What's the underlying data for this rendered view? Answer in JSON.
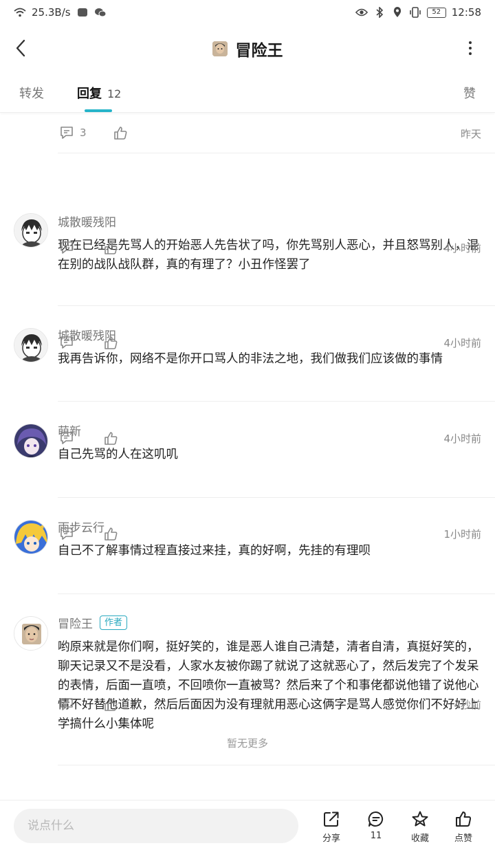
{
  "status_bar": {
    "network_speed": "25.3B/s",
    "battery": "52",
    "time": "12:58"
  },
  "header": {
    "title": "冒险王"
  },
  "tabs": {
    "forward": "转发",
    "reply": "回复",
    "reply_count": "12",
    "like": "赞"
  },
  "prev_comment": {
    "reply_count": "3",
    "time": "昨天"
  },
  "comments": [
    {
      "author": "城散暖残阳",
      "text": "现在已经是先骂人的开始恶人先告状了吗，你先骂别人恶心，并且怒骂别人，混在别的战队战队群，真的有理了？小丑作怪罢了",
      "time": "4小时前"
    },
    {
      "author": "城散暖残阳",
      "text": "我再告诉你，网络不是你开口骂人的非法之地，我们做我们应该做的事情",
      "time": "4小时前"
    },
    {
      "author": "萌新",
      "text": "自己先骂的人在这叽叽",
      "time": "4小时前"
    },
    {
      "author": "雨步云行",
      "text": "自己不了解事情过程直接过来挂，真的好啊，先挂的有理呗",
      "time": "1小时前"
    },
    {
      "author": "冒险王",
      "author_tag": "作者",
      "text": "哟原来就是你们啊，挺好笑的，谁是恶人谁自己清楚，清者自清，真挺好笑的，聊天记录又不是没看，人家水友被你踢了就说了这就恶心了，然后发完了个发呆的表情，后面一直喷，不回喷你一直被骂？然后来了个和事佬都说他错了说他心情不好替他道歉，然后后面因为没有理就用恶心这俩字是骂人感觉你们不好好上学搞什么小集体呢",
      "time": "4秒前"
    }
  ],
  "footer_note": "暂无更多",
  "bottom_bar": {
    "input_placeholder": "说点什么",
    "share_label": "分享",
    "comment_count": "11",
    "favorite_label": "收藏",
    "like_label": "点赞"
  },
  "colors": {
    "accent": "#26b4c9",
    "tag": "#2aa9bf",
    "muted": "#888888"
  }
}
